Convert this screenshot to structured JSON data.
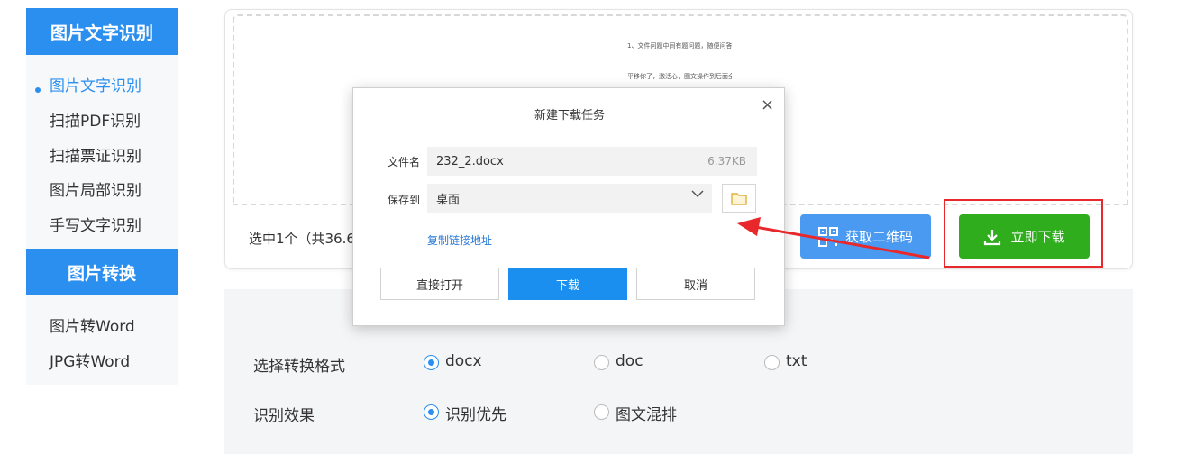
{
  "sidebar": {
    "section1_title": "图片文字识别",
    "section1_items": [
      "图片文字识别",
      "扫描PDF识别",
      "扫描票证识别",
      "图片局部识别",
      "手写文字识别"
    ],
    "section2_title": "图片转换",
    "section2_items": [
      "图片转Word",
      "JPG转Word"
    ]
  },
  "preview": {
    "thumb_lines": [
      "1、文件问题中间有题问题，随便问答",
      "平移你了，激活心，图文操作到后面全写"
    ],
    "selection_text": "选中1个（共36.6"
  },
  "actions": {
    "qr_label": "获取二维码",
    "download_label": "立即下载"
  },
  "options": {
    "format_label": "选择转换格式",
    "formats": [
      "docx",
      "doc",
      "txt"
    ],
    "selected_format": "docx",
    "effect_label": "识别效果",
    "effects": [
      "识别优先",
      "图文混排"
    ],
    "selected_effect": "识别优先"
  },
  "dialog": {
    "title": "新建下载任务",
    "close": "×",
    "filename_label": "文件名",
    "filename_value": "232_2.docx",
    "file_size": "6.37KB",
    "saveto_label": "保存到",
    "saveto_value": "桌面",
    "copy_link": "复制链接地址",
    "btn_open": "直接打开",
    "btn_download": "下载",
    "btn_cancel": "取消"
  },
  "colors": {
    "accent": "#2b8fef",
    "download_green": "#2fad1d",
    "highlight_red": "#e8282b"
  }
}
